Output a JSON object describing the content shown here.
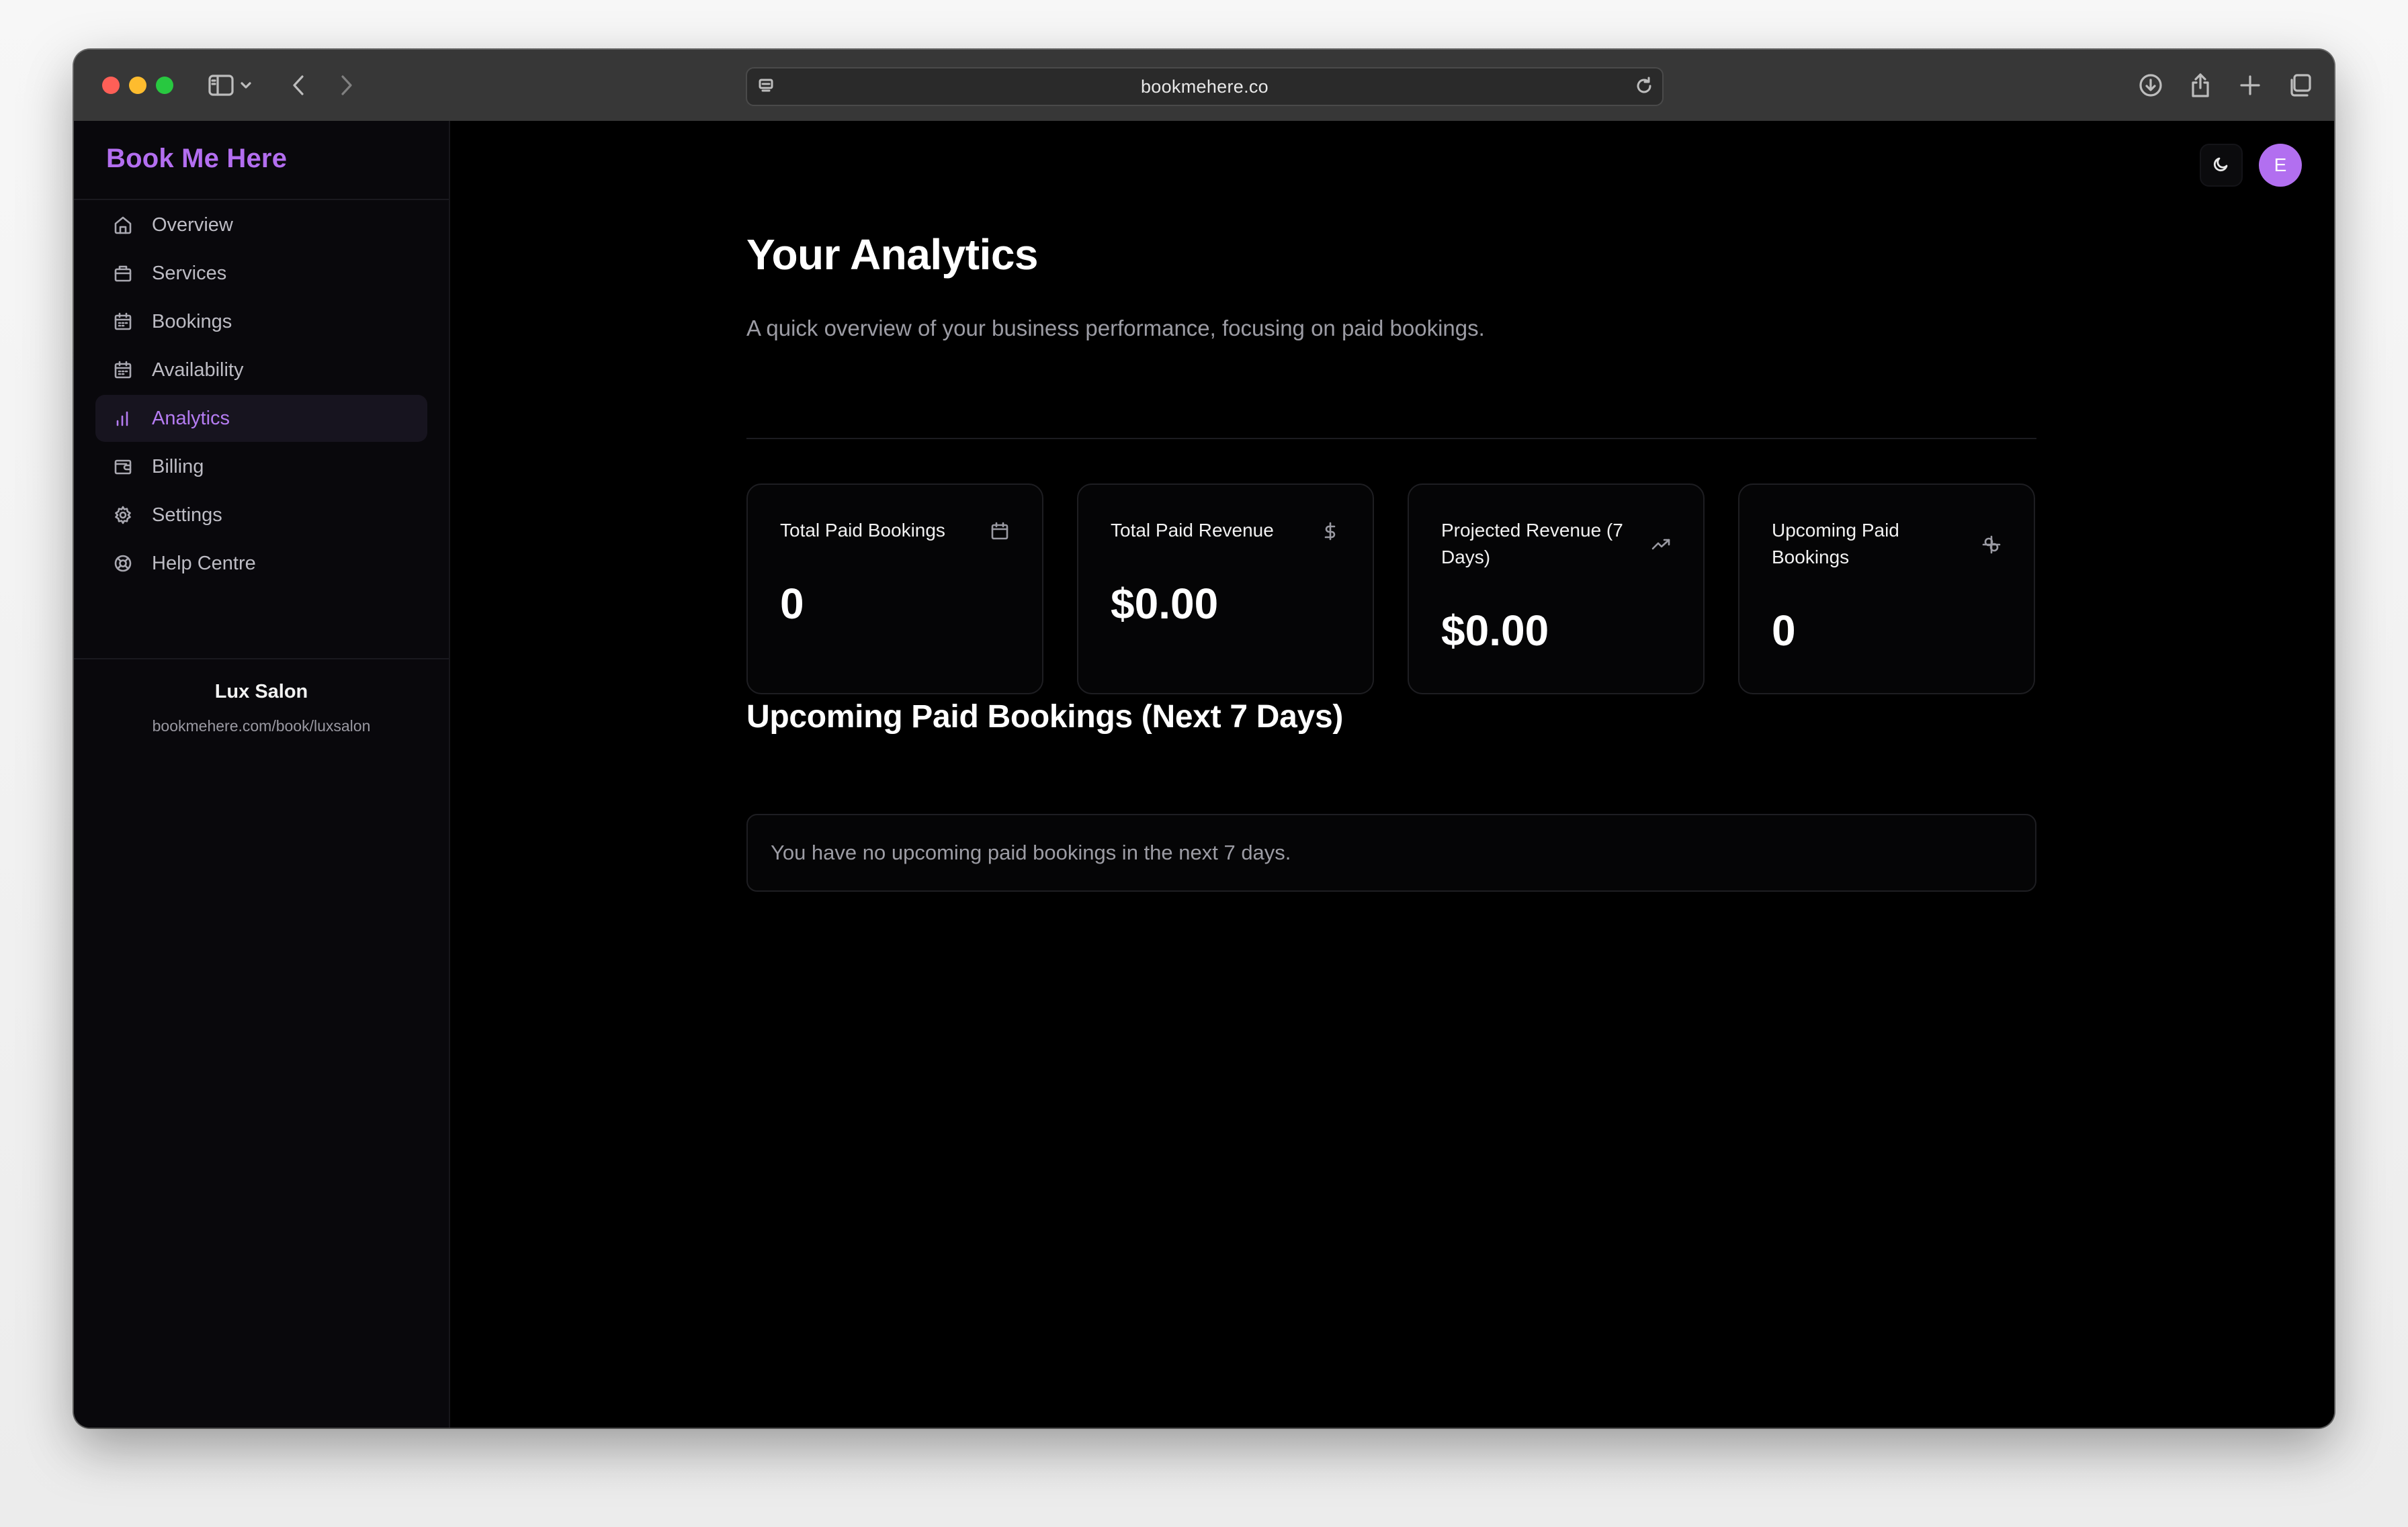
{
  "browser": {
    "url": "bookmehere.co"
  },
  "sidebar": {
    "brand": "Book Me Here",
    "items": [
      {
        "label": "Overview",
        "icon": "home-icon",
        "active": false
      },
      {
        "label": "Services",
        "icon": "briefcase-icon",
        "active": false
      },
      {
        "label": "Bookings",
        "icon": "calendar-icon",
        "active": false
      },
      {
        "label": "Availability",
        "icon": "calendar-icon",
        "active": false
      },
      {
        "label": "Analytics",
        "icon": "bar-chart-icon",
        "active": true
      },
      {
        "label": "Billing",
        "icon": "wallet-icon",
        "active": false
      },
      {
        "label": "Settings",
        "icon": "gear-icon",
        "active": false
      },
      {
        "label": "Help Centre",
        "icon": "lifebuoy-icon",
        "active": false
      }
    ],
    "business": {
      "name": "Lux Salon",
      "url": "bookmehere.com/book/luxsalon"
    }
  },
  "header": {
    "avatar_initial": "E",
    "theme_icon": "moon-icon"
  },
  "main": {
    "title": "Your Analytics",
    "subtitle": "A quick overview of your business performance, focusing on paid bookings.",
    "cards": [
      {
        "label": "Total Paid Bookings",
        "value": "0",
        "icon": "calendar-icon"
      },
      {
        "label": "Total Paid Revenue",
        "value": "$0.00",
        "icon": "dollar-icon"
      },
      {
        "label": "Projected Revenue (7 Days)",
        "value": "$0.00",
        "icon": "trending-up-icon"
      },
      {
        "label": "Upcoming Paid Bookings",
        "value": "0",
        "icon": "activity-icon"
      }
    ],
    "upcoming": {
      "title": "Upcoming Paid Bookings (Next 7 Days)",
      "empty_message": "You have no upcoming paid bookings in the next 7 days."
    }
  },
  "colors": {
    "accent": "#b36ef0",
    "background": "#000000",
    "sidebar_bg": "#09080c"
  }
}
